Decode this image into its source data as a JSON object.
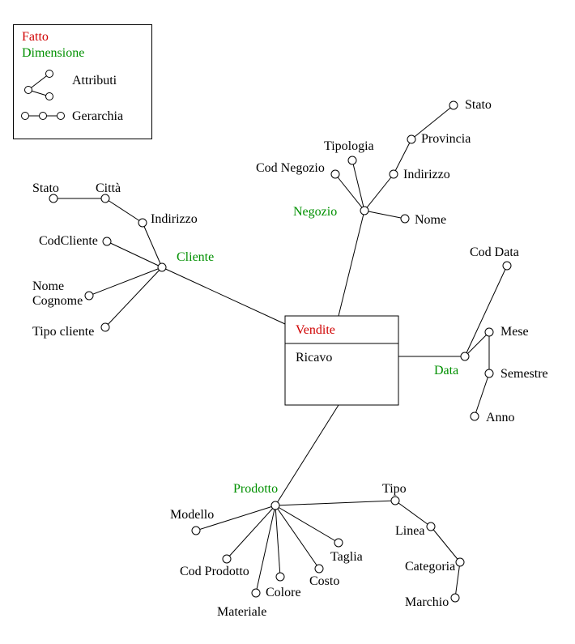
{
  "legend": {
    "fatto": "Fatto",
    "dimensione": "Dimensione",
    "attributi": "Attributi",
    "gerarchia": "Gerarchia"
  },
  "fact": {
    "name": "Vendite",
    "measure": "Ricavo"
  },
  "dimensions": {
    "cliente": {
      "label": "Cliente"
    },
    "negozio": {
      "label": "Negozio"
    },
    "data": {
      "label": "Data"
    },
    "prodotto": {
      "label": "Prodotto"
    }
  },
  "cliente_attrs": {
    "indirizzo": "Indirizzo",
    "citta": "Città",
    "stato": "Stato",
    "codcliente": "CodCliente",
    "nome_cognome_l1": "Nome",
    "nome_cognome_l2": "Cognome",
    "tipo_cliente": "Tipo cliente"
  },
  "negozio_attrs": {
    "cod_negozio": "Cod Negozio",
    "tipologia": "Tipologia",
    "indirizzo": "Indirizzo",
    "provincia": "Provincia",
    "stato": "Stato",
    "nome": "Nome"
  },
  "data_attrs": {
    "cod_data": "Cod Data",
    "mese": "Mese",
    "semestre": "Semestre",
    "anno": "Anno"
  },
  "prodotto_attrs": {
    "modello": "Modello",
    "cod_prodotto": "Cod Prodotto",
    "materiale": "Materiale",
    "colore": "Colore",
    "costo": "Costo",
    "taglia": "Taglia",
    "tipo": "Tipo",
    "linea": "Linea",
    "categoria": "Categoria",
    "marchio": "Marchio"
  }
}
